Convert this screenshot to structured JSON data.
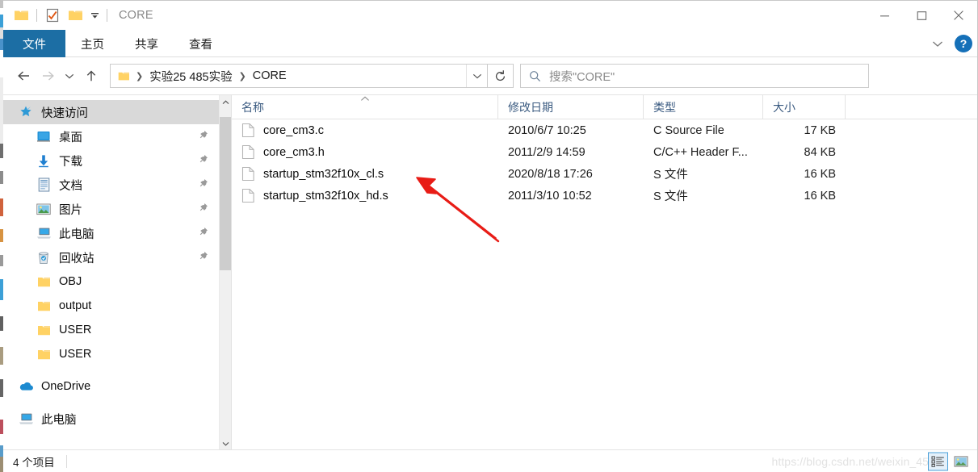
{
  "window": {
    "title": "CORE",
    "quick_access": [
      {
        "name": "folder-icon",
        "label": "文件夹"
      },
      {
        "name": "properties-icon",
        "label": "属性"
      },
      {
        "name": "new-folder-icon",
        "label": "新建文件夹"
      }
    ],
    "qat_dropdown_label": "自定义快速访问工具栏",
    "controls": {
      "minimize": "最小化",
      "maximize": "最大化",
      "close": "关闭"
    }
  },
  "ribbon": {
    "tabs": [
      {
        "label": "文件",
        "active": true
      },
      {
        "label": "主页",
        "active": false
      },
      {
        "label": "共享",
        "active": false
      },
      {
        "label": "查看",
        "active": false
      }
    ],
    "expand_label": "展开功能区",
    "help_label": "?"
  },
  "navigation": {
    "back_label": "后退",
    "forward_label": "前进",
    "recent_label": "最近浏览的位置",
    "up_label": "上移到",
    "refresh_label": "刷新",
    "address_dropdown_label": "上一个位置",
    "breadcrumbs": [
      {
        "label": "实验25 485实验"
      },
      {
        "label": "CORE"
      }
    ]
  },
  "search": {
    "placeholder": "搜索\"CORE\"",
    "icon": "search-icon"
  },
  "sidebar": {
    "items": [
      {
        "label": "快速访问",
        "icon": "star-icon",
        "level": 0,
        "selected": true,
        "pinned": false
      },
      {
        "label": "桌面",
        "icon": "desktop-icon",
        "level": 1,
        "selected": false,
        "pinned": true
      },
      {
        "label": "下载",
        "icon": "download-icon",
        "level": 1,
        "selected": false,
        "pinned": true
      },
      {
        "label": "文档",
        "icon": "document-icon",
        "level": 1,
        "selected": false,
        "pinned": true
      },
      {
        "label": "图片",
        "icon": "pictures-icon",
        "level": 1,
        "selected": false,
        "pinned": true
      },
      {
        "label": "此电脑",
        "icon": "computer-icon",
        "level": 1,
        "selected": false,
        "pinned": true
      },
      {
        "label": "回收站",
        "icon": "recycle-bin-icon",
        "level": 1,
        "selected": false,
        "pinned": true
      },
      {
        "label": "OBJ",
        "icon": "folder-icon",
        "level": 1,
        "selected": false,
        "pinned": false
      },
      {
        "label": "output",
        "icon": "folder-icon",
        "level": 1,
        "selected": false,
        "pinned": false
      },
      {
        "label": "USER",
        "icon": "folder-icon",
        "level": 1,
        "selected": false,
        "pinned": false
      },
      {
        "label": "USER",
        "icon": "folder-icon",
        "level": 1,
        "selected": false,
        "pinned": false
      },
      {
        "label": "OneDrive",
        "icon": "onedrive-icon",
        "level": 0,
        "selected": false,
        "pinned": false
      },
      {
        "label": "此电脑",
        "icon": "computer-icon",
        "level": 0,
        "selected": false,
        "pinned": false
      }
    ]
  },
  "file_list": {
    "columns": [
      {
        "key": "name",
        "label": "名称",
        "sorted": "asc"
      },
      {
        "key": "date",
        "label": "修改日期",
        "sorted": ""
      },
      {
        "key": "type",
        "label": "类型",
        "sorted": ""
      },
      {
        "key": "size",
        "label": "大小",
        "sorted": ""
      }
    ],
    "rows": [
      {
        "name": "core_cm3.c",
        "date": "2010/6/7 10:25",
        "type": "C Source File",
        "size": "17 KB",
        "icon": "file-icon"
      },
      {
        "name": "core_cm3.h",
        "date": "2011/2/9 14:59",
        "type": "C/C++ Header F...",
        "size": "84 KB",
        "icon": "file-icon"
      },
      {
        "name": "startup_stm32f10x_cl.s",
        "date": "2020/8/18 17:26",
        "type": "S 文件",
        "size": "16 KB",
        "icon": "file-icon"
      },
      {
        "name": "startup_stm32f10x_hd.s",
        "date": "2011/3/10 10:52",
        "type": "S 文件",
        "size": "16 KB",
        "icon": "file-icon"
      }
    ]
  },
  "annotation": {
    "color": "#e81c16",
    "points_at": "startup_stm32f10x_cl.s"
  },
  "statusbar": {
    "item_count": "4 个项目",
    "watermark": "https://blog.csdn.net/weixin_45",
    "views": [
      {
        "label": "详细信息",
        "icon": "details-view-icon",
        "active": true
      },
      {
        "label": "大图标",
        "icon": "large-icons-view-icon",
        "active": false
      }
    ]
  },
  "colors": {
    "accent": "#1c6ea4",
    "selection": "#d9d9d9",
    "annotation": "#e81c16",
    "folder": "#ffd264"
  }
}
